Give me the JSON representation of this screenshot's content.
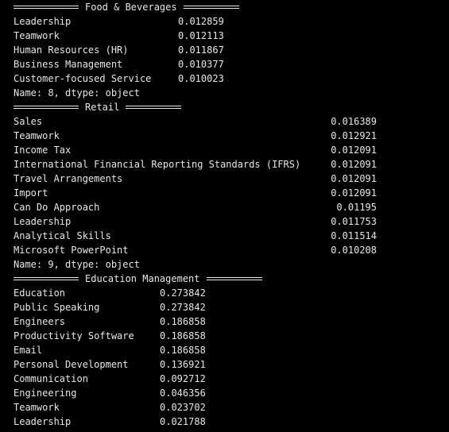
{
  "colors": {
    "background": "#000000",
    "text": "#e6e6e6"
  },
  "sections": [
    {
      "header": "Food & Beverages",
      "rows": [
        {
          "label": "Leadership",
          "value": "0.012859"
        },
        {
          "label": "Teamwork",
          "value": "0.012113"
        },
        {
          "label": "Human Resources (HR)",
          "value": "0.011867"
        },
        {
          "label": "Business Management",
          "value": "0.010377"
        },
        {
          "label": "Customer-focused Service",
          "value": "0.010023"
        }
      ],
      "footer": "Name: 8, dtype: object"
    },
    {
      "header": "Retail",
      "rows": [
        {
          "label": "Sales",
          "value": "0.016389"
        },
        {
          "label": "Teamwork",
          "value": "0.012921"
        },
        {
          "label": "Income Tax",
          "value": "0.012091"
        },
        {
          "label": "International Financial Reporting Standards (IFRS)",
          "value": "0.012091"
        },
        {
          "label": "Travel Arrangements",
          "value": "0.012091"
        },
        {
          "label": "Import",
          "value": "0.012091"
        },
        {
          "label": "Can Do Approach",
          "value": "0.01195"
        },
        {
          "label": "Leadership",
          "value": "0.011753"
        },
        {
          "label": "Analytical Skills",
          "value": "0.011514"
        },
        {
          "label": "Microsoft PowerPoint",
          "value": "0.010208"
        }
      ],
      "footer": "Name: 9, dtype: object"
    },
    {
      "header": "Education Management",
      "rows": [
        {
          "label": "Education",
          "value": "0.273842"
        },
        {
          "label": "Public Speaking",
          "value": "0.273842"
        },
        {
          "label": "Engineers",
          "value": "0.186858"
        },
        {
          "label": "Productivity Software",
          "value": "0.186858"
        },
        {
          "label": "Email",
          "value": "0.186858"
        },
        {
          "label": "Personal Development",
          "value": "0.136921"
        },
        {
          "label": "Communication",
          "value": "0.092712"
        },
        {
          "label": "Engineering",
          "value": "0.046356"
        },
        {
          "label": "Teamwork",
          "value": "0.023702"
        },
        {
          "label": "Leadership",
          "value": "0.021788"
        }
      ]
    }
  ]
}
